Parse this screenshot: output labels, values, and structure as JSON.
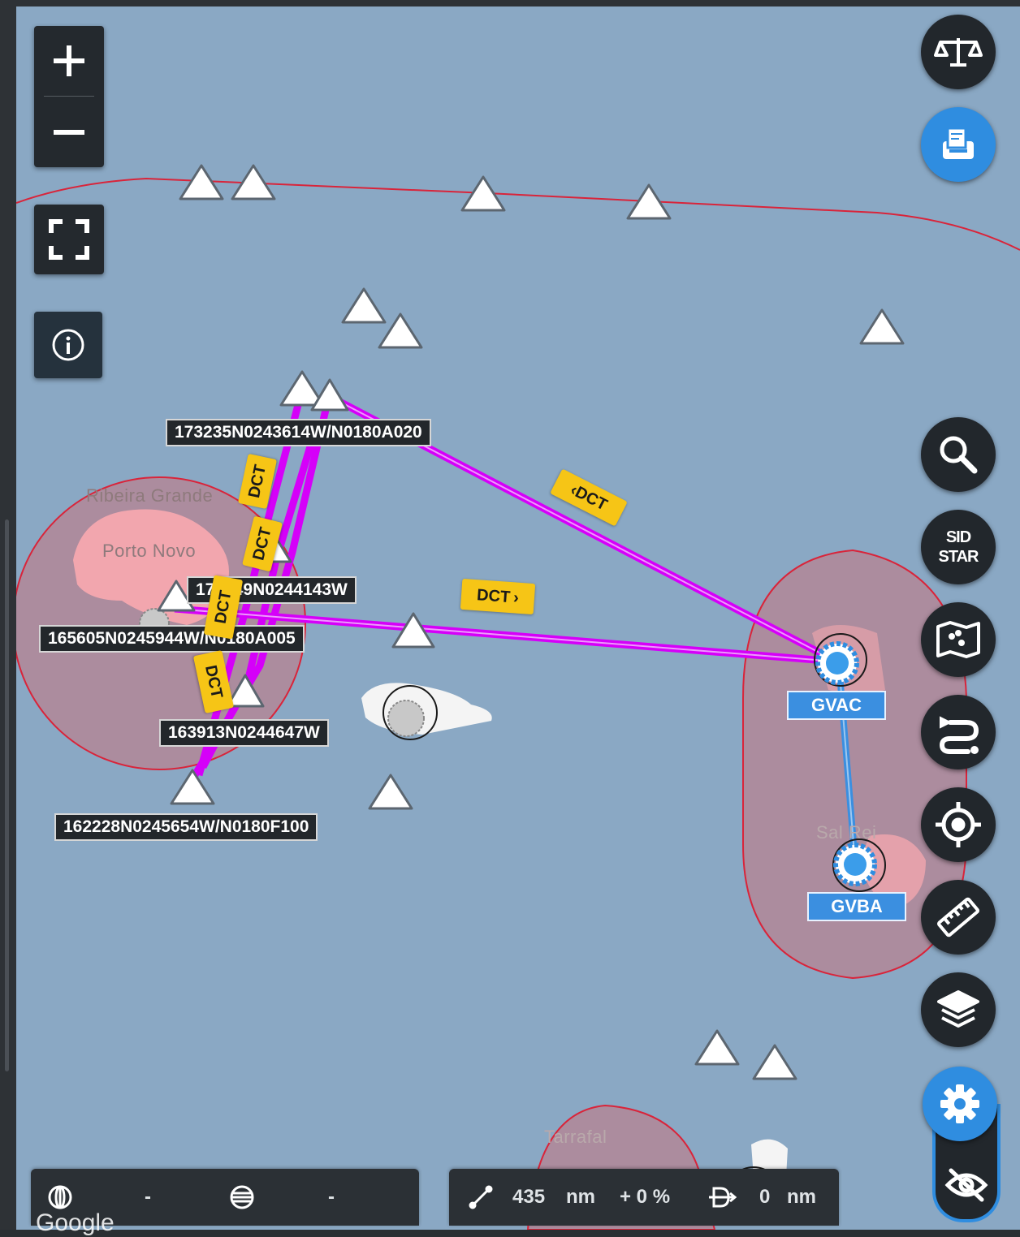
{
  "map": {
    "background": "#8aa8c4",
    "route_color": "#d500f9",
    "direct_leg_color": "#3b8fe0",
    "restricted_area_color": "#e06a78"
  },
  "controls": {
    "zoom_in_icon": "plus-icon",
    "zoom_out_icon": "minus-icon",
    "fullscreen_icon": "fullscreen-icon",
    "info_icon": "info-icon"
  },
  "right_toolbar": {
    "buttons": [
      {
        "name": "scale-balance",
        "icon": "balance-icon"
      },
      {
        "name": "flight-plan",
        "icon": "printer-icon"
      },
      {
        "name": "search",
        "icon": "search-icon"
      },
      {
        "name": "sid-star",
        "line1": "SID",
        "line2": "STAR"
      },
      {
        "name": "map-layers-map",
        "icon": "map-icon"
      },
      {
        "name": "route",
        "icon": "route-icon"
      },
      {
        "name": "locate",
        "icon": "crosshair-icon"
      },
      {
        "name": "ruler",
        "icon": "ruler-icon"
      },
      {
        "name": "layers",
        "icon": "layers-icon"
      },
      {
        "name": "settings",
        "icon": "gear-icon"
      },
      {
        "name": "visibility",
        "icon": "eye-off-icon"
      }
    ]
  },
  "waypoints": [
    {
      "label": "173235N0243614W/N0180A020"
    },
    {
      "label": "170449N0244143W"
    },
    {
      "label": "165605N0245944W/N0180A005"
    },
    {
      "label": "163913N0244647W"
    },
    {
      "label": "162228N0245654W/N0180F100"
    }
  ],
  "airports": [
    {
      "code": "GVAC"
    },
    {
      "code": "GVBA"
    }
  ],
  "dct_labels": [
    {
      "text": "DCT",
      "arrow": "‹"
    },
    {
      "text": "DCT",
      "arrow": "›"
    },
    {
      "text": "DCT"
    },
    {
      "text": "DCT"
    },
    {
      "text": "DCT"
    },
    {
      "text": "DCT"
    }
  ],
  "towns": [
    {
      "name": "Ribeira Grande"
    },
    {
      "name": "Porto Novo"
    },
    {
      "name": "Tarrafal"
    },
    {
      "name": "Sal Rei"
    }
  ],
  "bottom_left": {
    "value1": "-",
    "value2": "-"
  },
  "bottom_right": {
    "distance": "435",
    "distance_unit": "nm",
    "percent": "+ 0 %",
    "offset": "0",
    "offset_unit": "nm"
  },
  "attribution": "Google"
}
